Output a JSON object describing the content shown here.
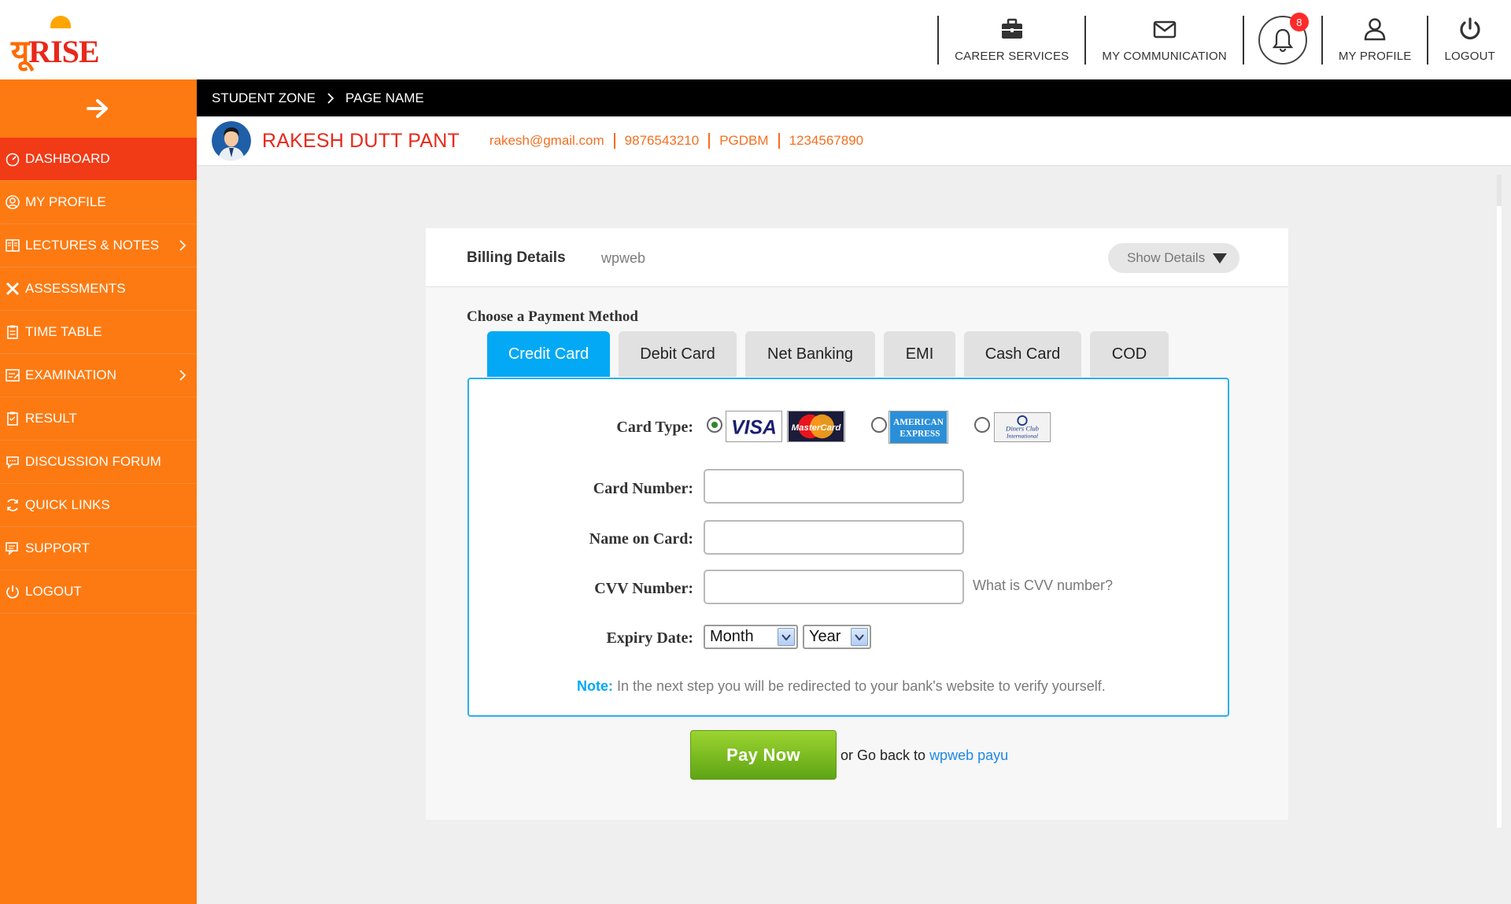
{
  "brand": {
    "logo_text_main": "यू",
    "logo_text_accent": "RISE"
  },
  "header_nav": {
    "career_services": "CAREER SERVICES",
    "my_communication": "MY COMMUNICATION",
    "notifications_count": "8",
    "my_profile": "MY PROFILE",
    "logout": "LOGOUT"
  },
  "sidebar": {
    "items": [
      {
        "label": "DASHBOARD",
        "active": true
      },
      {
        "label": "MY PROFILE"
      },
      {
        "label": "LECTURES & NOTES",
        "has_submenu": true
      },
      {
        "label": "ASSESSMENTS"
      },
      {
        "label": "TIME TABLE"
      },
      {
        "label": "EXAMINATION",
        "has_submenu": true
      },
      {
        "label": "RESULT"
      },
      {
        "label": "DISCUSSION FORUM"
      },
      {
        "label": "QUICK LINKS"
      },
      {
        "label": "SUPPORT"
      },
      {
        "label": "LOGOUT"
      }
    ]
  },
  "breadcrumb": {
    "root": "STUDENT ZONE",
    "current": "PAGE NAME"
  },
  "profile": {
    "name": "RAKESH DUTT PANT",
    "email": "rakesh@gmail.com",
    "phone": "9876543210",
    "program": "PGDBM",
    "id": "1234567890"
  },
  "billing": {
    "title": "Billing Details",
    "merchant": "wpweb",
    "show_details_label": "Show Details"
  },
  "payment": {
    "method_title": "Choose a Payment Method",
    "tabs": [
      "Credit Card",
      "Debit Card",
      "Net Banking",
      "EMI",
      "Cash Card",
      "COD"
    ],
    "active_tab": "Credit Card",
    "labels": {
      "card_type": "Card Type:",
      "card_number": "Card Number:",
      "name_on_card": "Name on Card:",
      "cvv_number": "CVV Number:",
      "expiry_date": "Expiry Date:"
    },
    "card_logos": {
      "visa": "VISA",
      "mastercard": "MasterCard",
      "amex_line1": "AMERICAN",
      "amex_line2": "EXPRESS",
      "diners_line1": "Diners Club",
      "diners_line2": "International"
    },
    "cvv_hint": "What is CVV number?",
    "month_value": "Month",
    "year_value": "Year",
    "note_label": "Note:",
    "note_text": " In the next step you will be redirected to your bank's website to verify yourself.",
    "pay_button": "Pay Now",
    "goback_prefix": "or Go back to ",
    "goback_link": "wpweb payu"
  },
  "colors": {
    "sidebar_bg": "#fd7a12",
    "sidebar_active": "#f13a16",
    "name_red": "#e8281b",
    "info_orange": "#f36f21",
    "tab_active": "#03a9f4",
    "pay_green": "#6fb51c"
  }
}
